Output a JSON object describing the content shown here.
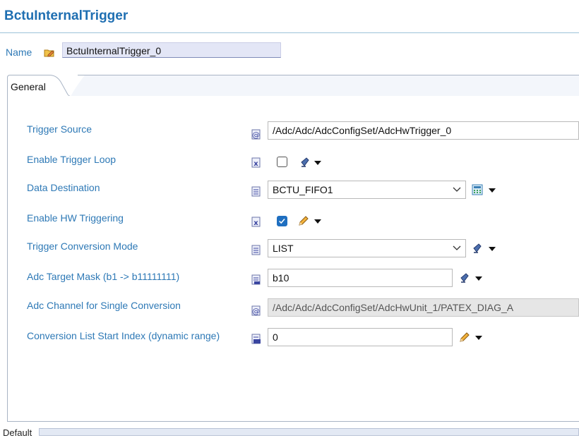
{
  "header": {
    "title": "BctuInternalTrigger"
  },
  "name_row": {
    "label": "Name",
    "value": "BctuInternalTrigger_0",
    "icon": "folder-pencil-icon"
  },
  "tabs": [
    {
      "label": "General",
      "active": true
    }
  ],
  "fields": [
    {
      "label": "Trigger Source",
      "value": "/Adc/Adc/AdcConfigSet/AdcHwTrigger_0",
      "kind": "reference",
      "icon": "at-reference-icon"
    },
    {
      "label": "Enable Trigger Loop",
      "checked": false,
      "kind": "checkbox",
      "icon": "boolean-icon",
      "action_icon": "default-value-icon"
    },
    {
      "label": "Data Destination",
      "value": "BCTU_FIFO1",
      "kind": "combo",
      "icon": "enum-icon",
      "action_icon": "calculator-icon"
    },
    {
      "label": "Enable HW Triggering",
      "checked": true,
      "kind": "checkbox",
      "icon": "boolean-icon",
      "action_icon": "pencil-icon"
    },
    {
      "label": "Trigger Conversion Mode",
      "value": "LIST",
      "kind": "combo",
      "icon": "enum-icon",
      "action_icon": "default-value-icon"
    },
    {
      "label": "Adc Target Mask (b1 -> b11111111)",
      "value": "b10",
      "kind": "text",
      "icon": "string-icon",
      "action_icon": "default-value-icon"
    },
    {
      "label": "Adc Channel for Single Conversion",
      "value": "/Adc/Adc/AdcConfigSet/AdcHwUnit_1/PATEX_DIAG_A",
      "kind": "reference-disabled",
      "icon": "at-reference-icon"
    },
    {
      "label": "Conversion List Start Index (dynamic range)",
      "value": "0",
      "kind": "text",
      "icon": "integer-icon",
      "action_icon": "pencil-icon"
    }
  ],
  "footer": {
    "label": "Default"
  },
  "colors": {
    "accent": "#1f6fb2",
    "label": "#2e79b6",
    "checkbox_checked": "#1f6fc0"
  }
}
